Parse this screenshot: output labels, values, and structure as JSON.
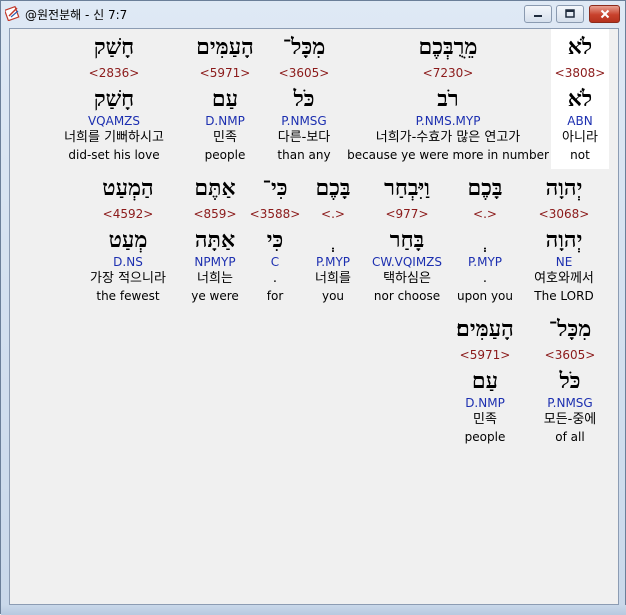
{
  "window": {
    "title": "@원전분해 - 신 7:7",
    "icons": {
      "app": "app-icon",
      "minimize": "minimize-icon",
      "maximize": "maximize-icon",
      "close": "close-icon"
    },
    "colors": {
      "strong_number": "#8b1a1a",
      "parsing": "#1c2fb0",
      "highlight": "#ffffff"
    }
  },
  "rows": [
    [
      {
        "hebrew": "לֹא",
        "strong": "<3808>",
        "root": "לֹא",
        "parse": "ABN",
        "korean": "아니라",
        "english": "not",
        "highlighted": true
      },
      {
        "hebrew": "מֵרֻבְּכֶם",
        "strong": "<7230>",
        "root": "רֹב",
        "parse": "P.NMS.MYP",
        "korean": "너희가-수효가 많은 연고가",
        "english": "because ye were more in number",
        "highlighted": false
      },
      {
        "hebrew": "מִכָּל־",
        "strong": "<3605>",
        "root": "כֹּל",
        "parse": "P.NMSG",
        "korean": "다른-보다",
        "english": "than any",
        "highlighted": false
      },
      {
        "hebrew": "הָעַמִּים",
        "strong": "<5971>",
        "root": "עַם",
        "parse": "D.NMP",
        "korean": "민족",
        "english": "people",
        "highlighted": false
      },
      {
        "hebrew": "חָשַׁק",
        "strong": "<2836>",
        "root": "חָשַׁק",
        "parse": "VQAMZS",
        "korean": "너희를 기뻐하시고",
        "english": "did-set his love",
        "highlighted": false
      }
    ],
    [
      {
        "hebrew": "יְהוָה",
        "strong": "<3068>",
        "root": "יְהוָה",
        "parse": "NE",
        "korean": "여호와께서",
        "english": "The LORD"
      },
      {
        "hebrew": "בָּכֶם",
        "strong": "<.>",
        "root": "ְ",
        "parse": "P.MYP",
        "korean": ".",
        "english": "upon you"
      },
      {
        "hebrew": "וַיִּבְחַר",
        "strong": "<977>",
        "root": "בָּחַר",
        "parse": "CW.VQIMZS",
        "korean": "택하심은",
        "english": "nor choose"
      },
      {
        "hebrew": "בָּכֶם",
        "strong": "<.>",
        "root": "ְ",
        "parse": "P.MYP",
        "korean": "너희를",
        "english": "you"
      },
      {
        "hebrew": "כִּי־",
        "strong": "<3588>",
        "root": "כִּי",
        "parse": "C",
        "korean": ".",
        "english": "for"
      },
      {
        "hebrew": "אַתֶּם",
        "strong": "<859>",
        "root": "אַתָּה",
        "parse": "NPMYP",
        "korean": "너희는",
        "english": "ye were"
      },
      {
        "hebrew": "הַמְעַט",
        "strong": "<4592>",
        "root": "מְעַט",
        "parse": "D.NS",
        "korean": "가장 적으니라",
        "english": "the fewest"
      }
    ],
    [
      {
        "hebrew": "מִכָּל־",
        "strong": "<3605>",
        "root": "כֹּל",
        "parse": "P.NMSG",
        "korean": "모든-중에",
        "english": "of all"
      },
      {
        "hebrew": "הָעַמִּים׃",
        "strong": "<5971>",
        "root": "עַם",
        "parse": "D.NMP",
        "korean": "민족",
        "english": "people"
      }
    ]
  ]
}
